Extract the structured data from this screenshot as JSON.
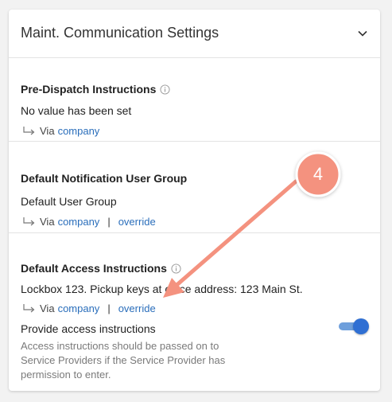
{
  "card": {
    "title": "Maint. Communication Settings",
    "collapse_icon": "chevron-down-icon"
  },
  "sections": [
    {
      "label": "Pre-Dispatch Instructions",
      "has_info": true,
      "value": "No value has been set",
      "via_prefix": "Via",
      "via_link": "company"
    },
    {
      "label": "Default Notification User Group",
      "has_info": false,
      "value": "Default User Group",
      "via_prefix": "Via",
      "via_link": "company",
      "separator": "|",
      "override_link": "override"
    },
    {
      "label": "Default Access Instructions",
      "has_info": true,
      "value": "Lockbox 123. Pickup keys at office address: 123 Main St.",
      "via_prefix": "Via",
      "via_link": "company",
      "separator": "|",
      "override_link": "override",
      "toggle": {
        "label": "Provide access instructions",
        "description": "Access instructions should be passed on to Service Providers if the Service Provider has permission to enter.",
        "on": true
      }
    }
  ],
  "annotation": {
    "step": "4",
    "color": "#f4927f"
  },
  "colors": {
    "link": "#2a6ebb",
    "toggle_track": "#6e9fdc",
    "toggle_knob": "#2f6fd3"
  }
}
